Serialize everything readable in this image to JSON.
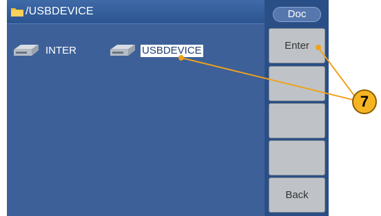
{
  "titlebar": {
    "path": "/USBDEVICE"
  },
  "drives": [
    {
      "label": "INTER",
      "selected": false
    },
    {
      "label": "USBDEVICE",
      "selected": true
    }
  ],
  "sidebar": {
    "tab": "Doc",
    "softkeys": [
      "Enter",
      "",
      "",
      "",
      "Back"
    ]
  },
  "callout": {
    "number": "7",
    "color": "#f6b423"
  },
  "colors": {
    "screen": "#2a4f86",
    "browser": "#3d6098",
    "softkey": "#bfc3c7",
    "callout_line": "#f0a11a"
  }
}
